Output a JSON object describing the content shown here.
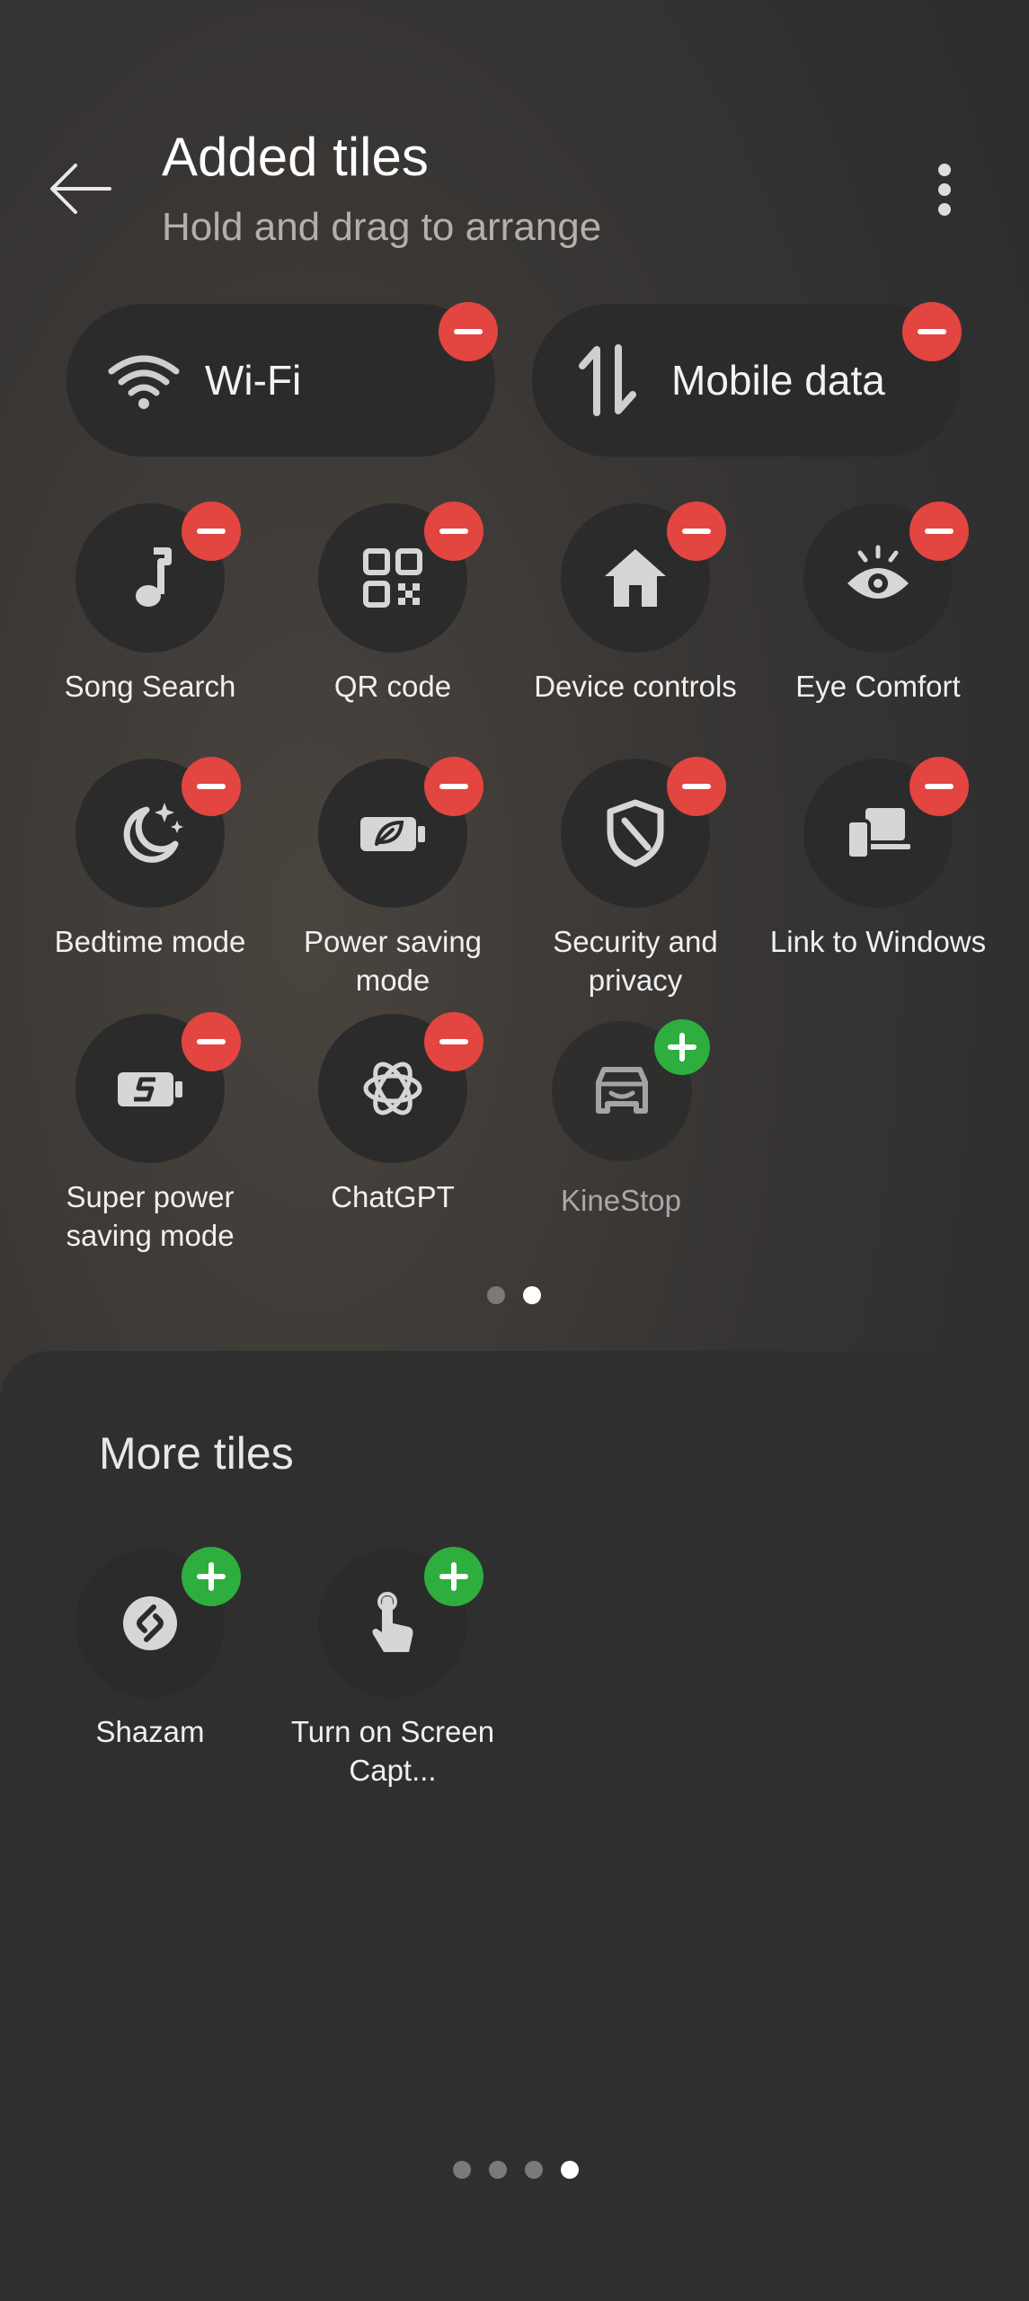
{
  "header": {
    "title": "Added tiles",
    "subtitle": "Hold and drag to arrange"
  },
  "wide_tiles": [
    {
      "label": "Wi-Fi",
      "icon": "wifi-icon"
    },
    {
      "label": "Mobile data",
      "icon": "mobile-data-icon"
    }
  ],
  "added_tiles": [
    {
      "label": "Song Search",
      "icon": "music-note-icon"
    },
    {
      "label": "QR code",
      "icon": "qr-code-icon"
    },
    {
      "label": "Device controls",
      "icon": "home-icon"
    },
    {
      "label": "Eye Comfort",
      "icon": "eye-icon"
    },
    {
      "label": "Bedtime mode",
      "icon": "moon-icon"
    },
    {
      "label": "Power saving mode",
      "icon": "battery-leaf-icon"
    },
    {
      "label": "Security and privacy",
      "icon": "shield-icon"
    },
    {
      "label": "Link to Windows",
      "icon": "devices-icon"
    },
    {
      "label": "Super power saving mode",
      "icon": "super-battery-icon"
    },
    {
      "label": "ChatGPT",
      "icon": "chatgpt-icon"
    },
    {
      "label": "KineStop",
      "icon": "car-icon"
    }
  ],
  "added_pager": {
    "count": 2,
    "active": 2
  },
  "more_tiles": {
    "title": "More tiles",
    "items": [
      {
        "label": "Shazam",
        "icon": "shazam-icon"
      },
      {
        "label": "Turn on Screen Capt...",
        "icon": "touch-icon"
      }
    ]
  },
  "pager": {
    "count": 4,
    "active": 4
  },
  "colors": {
    "remove_badge": "#e34540",
    "add_badge": "#2eae3f",
    "tile_bg": "#2b2b2b"
  }
}
